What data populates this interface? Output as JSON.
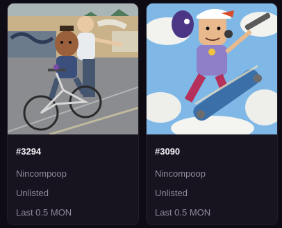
{
  "cards": [
    {
      "id": "#3294",
      "collection": "Nincompoop",
      "status": "Unlisted",
      "last_sale": "Last 0.5 MON"
    },
    {
      "id": "#3090",
      "collection": "Nincompoop",
      "status": "Unlisted",
      "last_sale": "Last 0.5 MON"
    }
  ],
  "colors": {
    "page_bg": "#0e0b14",
    "card_bg": "#18141f",
    "title_text": "#f2f0f5",
    "meta_text": "#8f8a99"
  }
}
